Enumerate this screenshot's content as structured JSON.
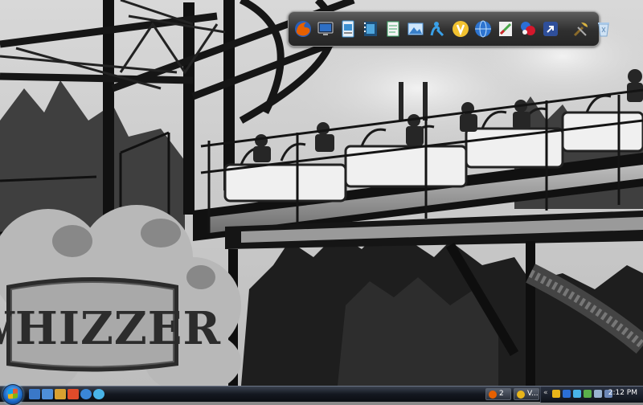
{
  "wallpaper": {
    "sign_text": "WHIZZER"
  },
  "dock": {
    "items": [
      {
        "icon": "firefox-icon",
        "color": "#e66000"
      },
      {
        "icon": "monitor-icon",
        "color": "#2f6fc4"
      },
      {
        "icon": "document-icon",
        "color": "#3a8fd1"
      },
      {
        "icon": "film-icon",
        "color": "#2d7bb8"
      },
      {
        "icon": "notepad-icon",
        "color": "#3fa86a"
      },
      {
        "icon": "image-icon",
        "color": "#5aa0e6"
      },
      {
        "icon": "messenger-icon",
        "color": "#39a0e8"
      },
      {
        "icon": "vlc-icon",
        "color": "#e8b51a"
      },
      {
        "icon": "globe-icon",
        "color": "#2d74d0"
      },
      {
        "icon": "paint-icon",
        "color": "#48a848"
      },
      {
        "icon": "color-picker-icon",
        "color": "#d4182c"
      },
      {
        "icon": "shortcut-arrow-icon",
        "color": "#4a6fd0"
      },
      {
        "icon": "tools-icon",
        "color": "#d8b240"
      },
      {
        "icon": "recycle-bin-icon",
        "color": "#a8c8e8"
      }
    ]
  },
  "taskbar": {
    "quick_launch": [
      {
        "icon": "show-desktop-icon",
        "color": "#3a78c8"
      },
      {
        "icon": "switch-windows-icon",
        "color": "#4e8ed8"
      },
      {
        "icon": "explorer-icon",
        "color": "#d8a030"
      },
      {
        "icon": "media-player-icon",
        "color": "#e04b2a"
      },
      {
        "icon": "internet-explorer-icon",
        "color": "#3a86d8"
      },
      {
        "icon": "messenger-small-icon",
        "color": "#49b4e8"
      }
    ],
    "tasks": [
      {
        "label": "2",
        "icon": "firefox-task-icon",
        "color": "#e66000"
      },
      {
        "label": "V...",
        "icon": "vlc-task-icon",
        "color": "#e8b51a"
      }
    ],
    "clock": "2:12 PM"
  }
}
